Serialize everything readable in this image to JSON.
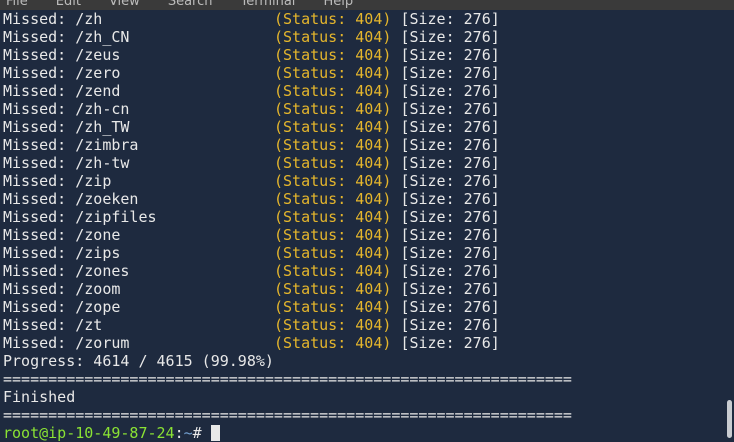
{
  "menu": [
    "File",
    "Edit",
    "View",
    "Search",
    "Terminal",
    "Help"
  ],
  "rows": [
    {
      "prefix": "Missed:",
      "path": "/zh",
      "status": "(Status: 404)",
      "size": "[Size: 276]"
    },
    {
      "prefix": "Missed:",
      "path": "/zh_CN",
      "status": "(Status: 404)",
      "size": "[Size: 276]"
    },
    {
      "prefix": "Missed:",
      "path": "/zeus",
      "status": "(Status: 404)",
      "size": "[Size: 276]"
    },
    {
      "prefix": "Missed:",
      "path": "/zero",
      "status": "(Status: 404)",
      "size": "[Size: 276]"
    },
    {
      "prefix": "Missed:",
      "path": "/zend",
      "status": "(Status: 404)",
      "size": "[Size: 276]"
    },
    {
      "prefix": "Missed:",
      "path": "/zh-cn",
      "status": "(Status: 404)",
      "size": "[Size: 276]"
    },
    {
      "prefix": "Missed:",
      "path": "/zh_TW",
      "status": "(Status: 404)",
      "size": "[Size: 276]"
    },
    {
      "prefix": "Missed:",
      "path": "/zimbra",
      "status": "(Status: 404)",
      "size": "[Size: 276]"
    },
    {
      "prefix": "Missed:",
      "path": "/zh-tw",
      "status": "(Status: 404)",
      "size": "[Size: 276]"
    },
    {
      "prefix": "Missed:",
      "path": "/zip",
      "status": "(Status: 404)",
      "size": "[Size: 276]"
    },
    {
      "prefix": "Missed:",
      "path": "/zoeken",
      "status": "(Status: 404)",
      "size": "[Size: 276]"
    },
    {
      "prefix": "Missed:",
      "path": "/zipfiles",
      "status": "(Status: 404)",
      "size": "[Size: 276]"
    },
    {
      "prefix": "Missed:",
      "path": "/zone",
      "status": "(Status: 404)",
      "size": "[Size: 276]"
    },
    {
      "prefix": "Missed:",
      "path": "/zips",
      "status": "(Status: 404)",
      "size": "[Size: 276]"
    },
    {
      "prefix": "Missed:",
      "path": "/zones",
      "status": "(Status: 404)",
      "size": "[Size: 276]"
    },
    {
      "prefix": "Missed:",
      "path": "/zoom",
      "status": "(Status: 404)",
      "size": "[Size: 276]"
    },
    {
      "prefix": "Missed:",
      "path": "/zope",
      "status": "(Status: 404)",
      "size": "[Size: 276]"
    },
    {
      "prefix": "Missed:",
      "path": "/zt",
      "status": "(Status: 404)",
      "size": "[Size: 276]"
    },
    {
      "prefix": "Missed:",
      "path": "/zorum",
      "status": "(Status: 404)",
      "size": "[Size: 276]"
    }
  ],
  "progress": "Progress: 4614 / 4615 (99.98%)",
  "separator": "===============================================================",
  "finished": "Finished",
  "prompt": {
    "user_host": "root@ip-10-49-87-24",
    "colon": ":",
    "path": "~",
    "symbol": "#"
  },
  "scroll_position": 0.95
}
